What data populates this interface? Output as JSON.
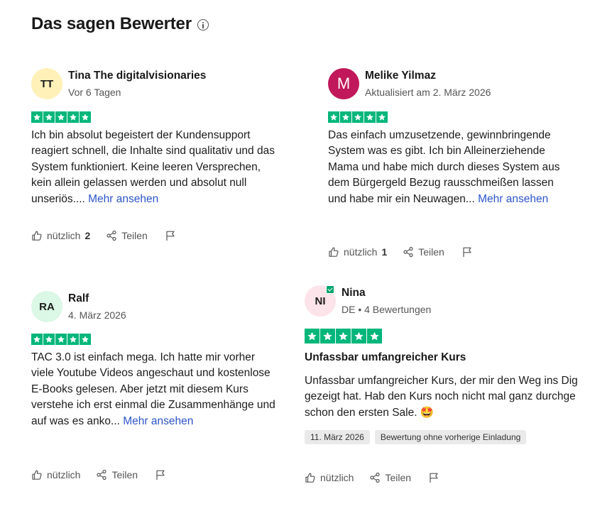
{
  "section": {
    "title": "Das sagen Bewerter"
  },
  "reviews": [
    {
      "initials": "TT",
      "avatar_color": "#fff1b8",
      "name": "Tina The digitalvisionaries",
      "meta": "Vor 6 Tagen",
      "rating": 5,
      "body": "Ich bin absolut begeistert der Kundensupport reagiert schnell, die Inhalte sind qualitativ und das System funktioniert. Keine leeren Versprechen, kein allein gelassen werden und absolut null unseriös....",
      "more": "Mehr ansehen",
      "useful_label": "nützlich",
      "useful_count": "2",
      "share_label": "Teilen"
    },
    {
      "initials": "M",
      "avatar_color": "#c0185a",
      "name": "Melike Yilmaz",
      "meta": "Aktualisiert am 2. März 2026",
      "rating": 5,
      "body": "Das einfach umzusetzende, gewinnbringende System was es gibt. Ich bin Alleinerziehende Mama und habe mich durch dieses System aus dem Bürgergeld Bezug rausschmeißen lassen und habe mir ein Neuwagen...",
      "more": "Mehr ansehen",
      "useful_label": "nützlich",
      "useful_count": "1",
      "share_label": "Teilen"
    },
    {
      "initials": "RA",
      "avatar_color": "#dbf7e5",
      "name": "Ralf",
      "meta": "4. März 2026",
      "rating": 5,
      "body": "TAC 3.0 ist einfach mega. Ich hatte mir vorher viele Youtube Videos angeschaut und kostenlose E-Books gelesen. Aber jetzt mit diesem Kurs verstehe ich erst einmal die Zusammenhänge und auf was es anko...",
      "more": "Mehr ansehen",
      "useful_label": "nützlich",
      "share_label": "Teilen"
    },
    {
      "initials": "NI",
      "avatar_color": "#fde3ea",
      "name": "Nina",
      "meta": "DE • 4 Bewertungen",
      "rating": 5,
      "title": "Unfassbar umfangreicher Kurs",
      "body": "Unfassbar umfangreicher Kurs, der mir den Weg ins Dig gezeigt hat. Hab den Kurs noch nicht mal ganz durchge schon den ersten Sale. 🤩",
      "date_chip": "11. März 2026",
      "invite_chip": "Bewertung ohne vorherige Einladung",
      "useful_label": "nützlich",
      "share_label": "Teilen"
    }
  ]
}
